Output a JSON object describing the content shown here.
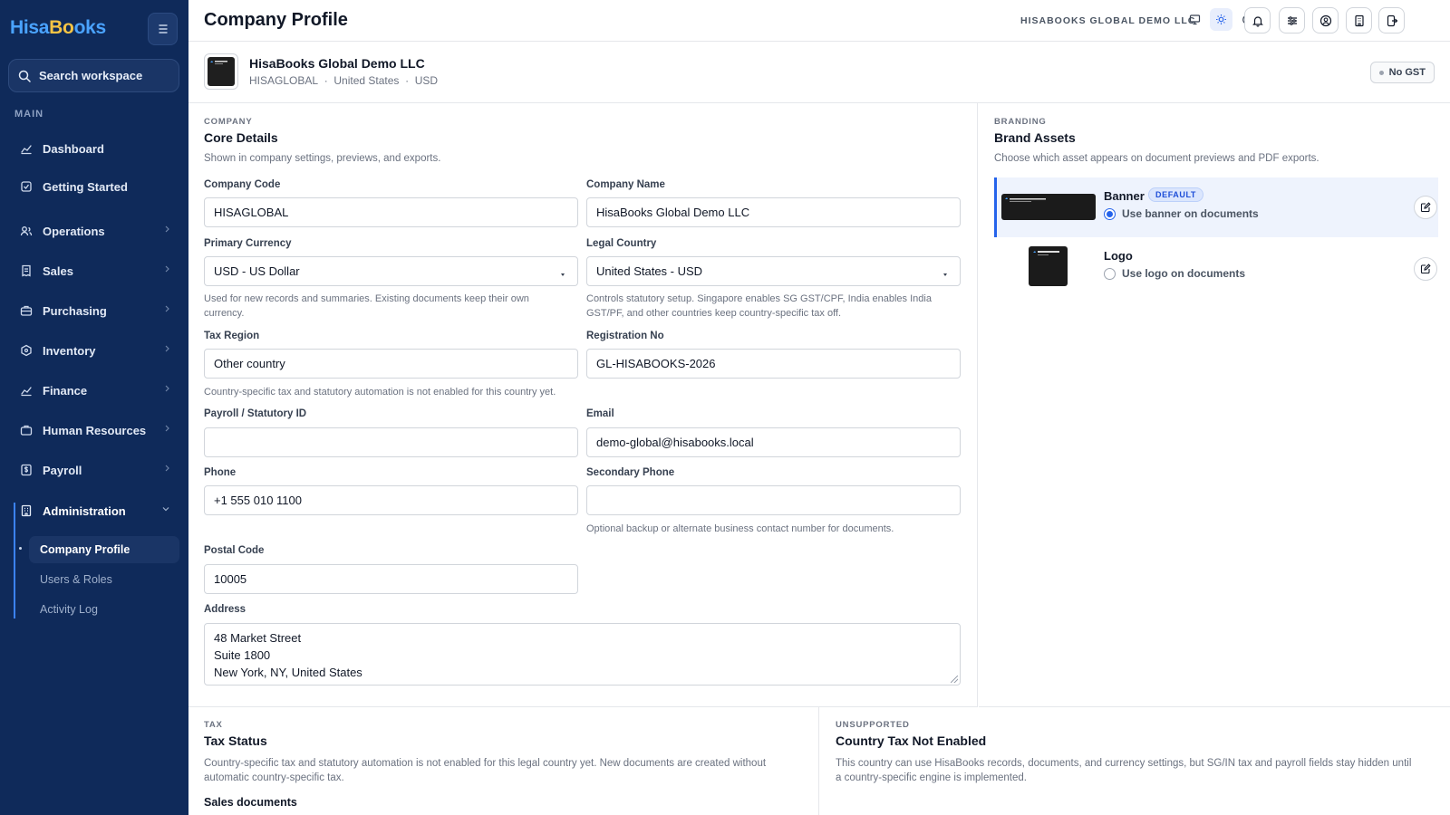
{
  "brand": {
    "part1": "Hisa",
    "part2": "Bo",
    "part3": "oks"
  },
  "sidebar": {
    "search_placeholder": "Search workspace",
    "section_main": "MAIN",
    "items": [
      {
        "label": "Dashboard"
      },
      {
        "label": "Getting Started"
      },
      {
        "label": "Operations"
      },
      {
        "label": "Sales"
      },
      {
        "label": "Purchasing"
      },
      {
        "label": "Inventory"
      },
      {
        "label": "Finance"
      },
      {
        "label": "Human Resources"
      },
      {
        "label": "Payroll"
      },
      {
        "label": "Administration"
      }
    ],
    "admin_sub": [
      {
        "label": "Company Profile"
      },
      {
        "label": "Users & Roles"
      },
      {
        "label": "Activity Log"
      }
    ]
  },
  "header": {
    "title": "Company Profile",
    "company_tag": "HISABOOKS GLOBAL DEMO LLC",
    "theme_options": [
      "monitor-icon",
      "sun-icon",
      "moon-icon"
    ],
    "actions": [
      "bell-icon",
      "sliders-icon",
      "user-circle-icon",
      "building-icon",
      "logout-icon"
    ]
  },
  "company": {
    "name": "HisaBooks Global Demo LLC",
    "code": "HISAGLOBAL",
    "country": "United States",
    "currency": "USD",
    "sep": "·",
    "gst_status": "No GST"
  },
  "core": {
    "eyebrow": "COMPANY",
    "title": "Core Details",
    "desc": "Shown in company settings, previews, and exports.",
    "fields": {
      "company_code": {
        "label": "Company Code",
        "value": "HISAGLOBAL"
      },
      "company_name": {
        "label": "Company Name",
        "value": "HisaBooks Global Demo LLC"
      },
      "primary_currency": {
        "label": "Primary Currency",
        "value": "USD - US Dollar",
        "help1": "Used for new records and summaries. Existing documents keep their own",
        "help2": "currency."
      },
      "legal_country": {
        "label": "Legal Country",
        "value": "United States - USD",
        "help1": "Controls statutory setup. Singapore enables SG GST/CPF, India enables India",
        "help2": "GST/PF, and other countries keep country-specific tax off."
      },
      "tax_region": {
        "label": "Tax Region",
        "value": "Other country",
        "help": "Country-specific tax and statutory automation is not enabled for this country yet."
      },
      "registration_no": {
        "label": "Registration No",
        "value": "GL-HISABOOKS-2026"
      },
      "payroll_id": {
        "label": "Payroll / Statutory ID",
        "value": ""
      },
      "email": {
        "label": "Email",
        "value": "demo-global@hisabooks.local"
      },
      "phone": {
        "label": "Phone",
        "value": "+1 555 010 1100"
      },
      "secondary_phone": {
        "label": "Secondary Phone",
        "value": "",
        "help": "Optional backup or alternate business contact number for documents."
      },
      "postal_code": {
        "label": "Postal Code",
        "value": "10005"
      },
      "address": {
        "label": "Address",
        "line1": "48 Market Street",
        "line2": "Suite 1800",
        "line3": "New York, NY, United States"
      }
    }
  },
  "branding": {
    "eyebrow": "BRANDING",
    "title": "Brand Assets",
    "desc": "Choose which asset appears on document previews and PDF exports.",
    "assets": [
      {
        "name": "Banner",
        "badge": "DEFAULT",
        "option": "Use banner on documents",
        "selected": true
      },
      {
        "name": "Logo",
        "option": "Use logo on documents",
        "selected": false
      }
    ]
  },
  "tax": {
    "eyebrow": "TAX",
    "title": "Tax Status",
    "desc1": "Country-specific tax and statutory automation is not enabled for this legal country yet. New documents are created without",
    "desc2": "automatic country-specific tax.",
    "sub": "Sales documents"
  },
  "unsupported": {
    "eyebrow": "UNSUPPORTED",
    "title": "Country Tax Not Enabled",
    "desc1": "This country can use HisaBooks records, documents, and currency settings, but SG/IN tax and payroll fields stay hidden until",
    "desc2": "a country-specific engine is implemented."
  },
  "colors": {
    "sidebar_bg": "#0f2a5a",
    "accent": "#2563eb",
    "brand_blue": "#4aa3ff",
    "brand_yellow": "#f6c445"
  }
}
